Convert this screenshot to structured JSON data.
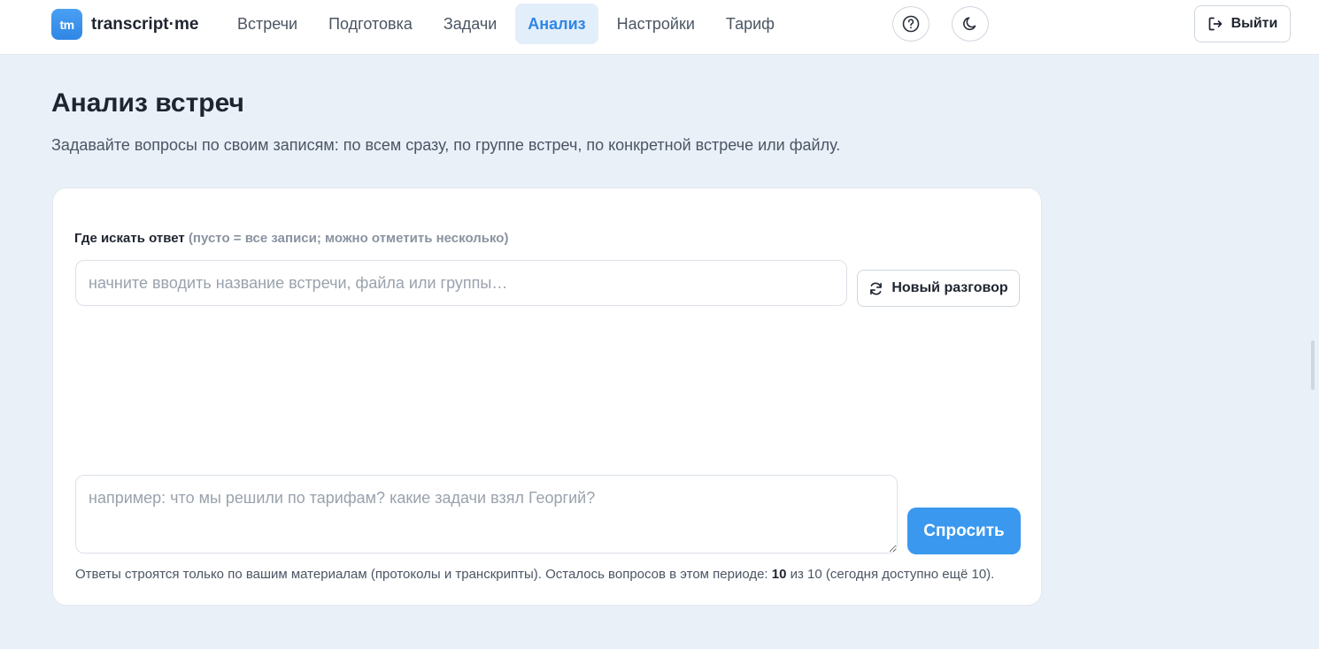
{
  "app": {
    "logo_mark": "tm",
    "logo_text": "transcript·me"
  },
  "nav": {
    "items": [
      {
        "label": "Встречи",
        "active": false
      },
      {
        "label": "Подготовка",
        "active": false
      },
      {
        "label": "Задачи",
        "active": false
      },
      {
        "label": "Анализ",
        "active": true
      },
      {
        "label": "Настройки",
        "active": false
      },
      {
        "label": "Тариф",
        "active": false
      }
    ]
  },
  "header": {
    "help_icon": "question-circle-icon",
    "theme_icon": "moon-icon",
    "logout_label": "Выйти",
    "logout_icon": "logout-icon"
  },
  "page": {
    "title": "Анализ встреч",
    "subtitle": "Задавайте вопросы по своим записям: по всем сразу, по группе встреч, по конкретной встрече или файлу."
  },
  "scope": {
    "label": "Где искать ответ",
    "hint": "(пусто = все записи; можно отметить несколько)",
    "placeholder": "начните вводить название встречи, файла или группы…",
    "value": ""
  },
  "new_chat": {
    "label": "Новый разговор",
    "icon": "refresh-icon"
  },
  "question": {
    "placeholder": "например: что мы решили по тарифам? какие задачи взял Георгий?",
    "value": ""
  },
  "ask": {
    "label": "Спросить"
  },
  "footnote": {
    "text_before": "Ответы строятся только по вашим материалам (протоколы и транскрипты). Осталось вопросов в этом периоде: ",
    "remaining": "10",
    "text_after": " из 10 (сегодня доступно ещё 10)."
  },
  "colors": {
    "accent": "#3a98ef",
    "nav_active_bg": "#e3eefb",
    "page_bg": "#eaf0f8"
  }
}
